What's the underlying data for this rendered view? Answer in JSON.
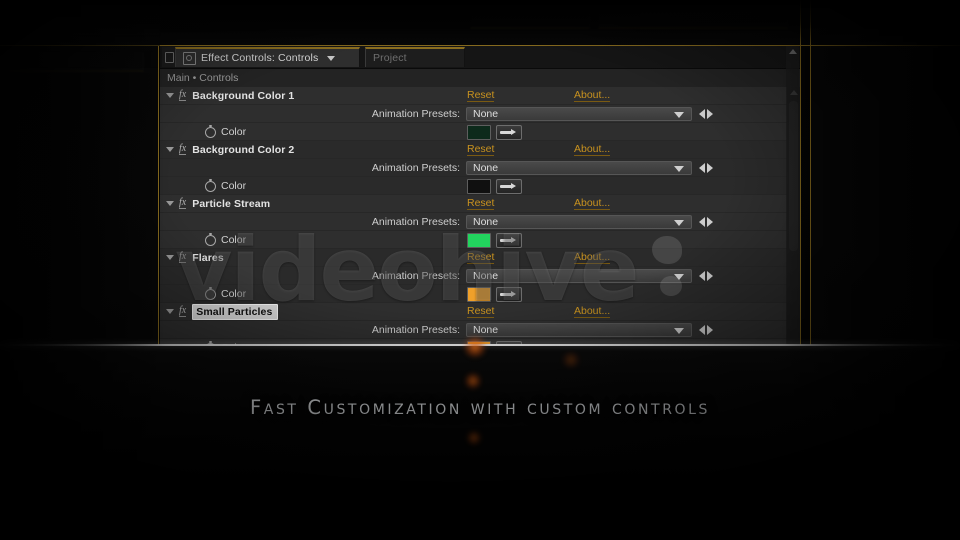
{
  "app": {
    "panel_title": "Effect Controls: Controls",
    "secondary_tab": "Project",
    "breadcrumb": "Main • Controls",
    "accent_gold": "#c8921f",
    "panel_bg": "#2e2e2e",
    "tab_border": "#8a6d1e"
  },
  "labels": {
    "reset": "Reset",
    "about": "About...",
    "animation_presets": "Animation Presets:",
    "color": "Color",
    "preset_value": "None"
  },
  "effects": [
    {
      "name": "Background Color 1",
      "reset": "Reset",
      "about": "About...",
      "preset_label": "Animation Presets:",
      "preset_value": "None",
      "color_label": "Color",
      "swatch": "#0d2a1b",
      "renaming": false
    },
    {
      "name": "Background Color 2",
      "reset": "Reset",
      "about": "About...",
      "preset_label": "Animation Presets:",
      "preset_value": "None",
      "color_label": "Color",
      "swatch": "#101010",
      "renaming": false
    },
    {
      "name": "Particle Stream",
      "reset": "Reset",
      "about": "About...",
      "preset_label": "Animation Presets:",
      "preset_value": "None",
      "color_label": "Color",
      "swatch": "#22d45e",
      "renaming": false
    },
    {
      "name": "Flares",
      "reset": "Reset",
      "about": "About...",
      "preset_label": "Animation Presets:",
      "preset_value": "None",
      "color_label": "Color",
      "swatch": "#f0a02a",
      "renaming": false
    },
    {
      "name": "Small Particles",
      "reset": "Reset",
      "about": "About...",
      "preset_label": "Animation Presets:",
      "preset_value": "None",
      "color_label": "Color",
      "swatch": "#ef9a1e",
      "renaming": true
    }
  ],
  "watermark": {
    "text": "videohive"
  },
  "caption": {
    "text": "Fast Customization with custom controls"
  },
  "icons": {
    "panel_menu": "panel-menu-icon",
    "tab_chevron": "chevron-down-icon",
    "stopwatch": "stopwatch-icon",
    "eyedropper": "eyedropper-icon",
    "expand_triangle": "triangle-down-icon",
    "prev_next": "prev-next-arrows-icon",
    "scroll_up": "scroll-up-arrow-icon"
  }
}
